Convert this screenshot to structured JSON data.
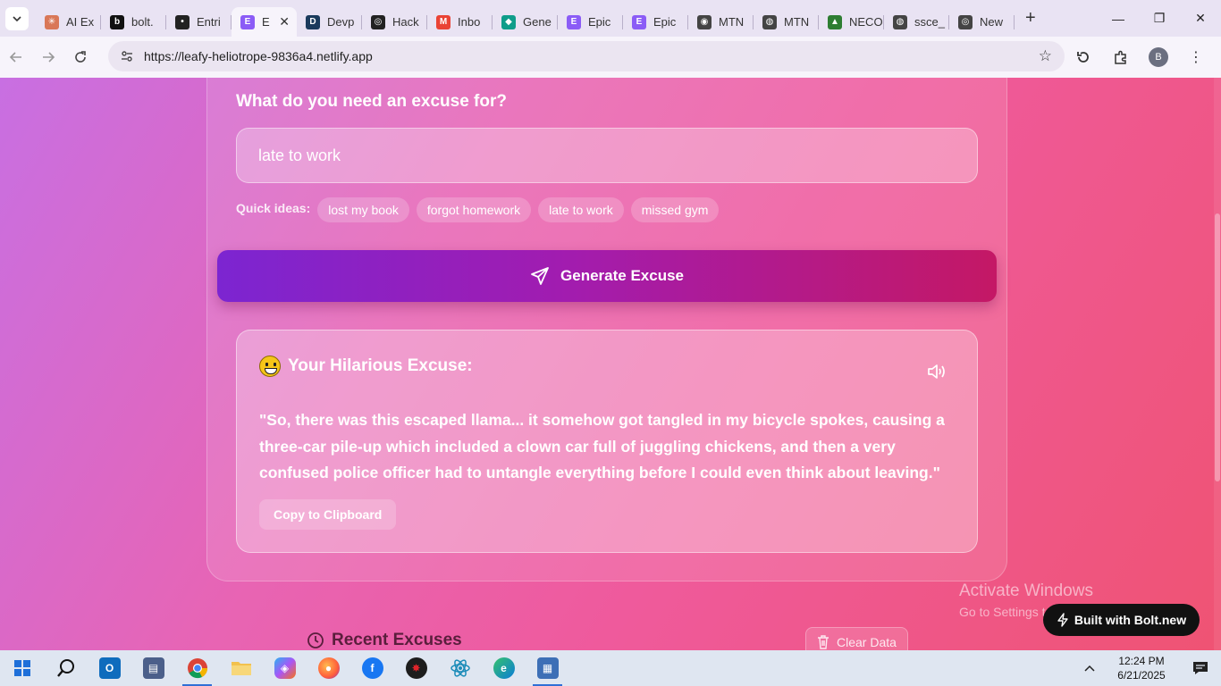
{
  "browser": {
    "tabs": [
      {
        "label": "AI Ex",
        "icon": "claude-icon",
        "color": "#d97757",
        "glyph": "✳"
      },
      {
        "label": "bolt.",
        "icon": "bolt-b-icon",
        "color": "#111111",
        "glyph": "b"
      },
      {
        "label": "Entri",
        "icon": "entri-icon",
        "color": "#222222",
        "glyph": "•"
      },
      {
        "label": "E",
        "icon": "epic-e-icon",
        "color": "#8b5cf6",
        "glyph": "E",
        "active": true
      },
      {
        "label": "Devp",
        "icon": "devpost-icon",
        "color": "#1a3a5c",
        "glyph": "D"
      },
      {
        "label": "Hack",
        "icon": "openai-icon",
        "color": "#222222",
        "glyph": "◎"
      },
      {
        "label": "Inbo",
        "icon": "gmail-icon",
        "color": "#ea4335",
        "glyph": "M"
      },
      {
        "label": "Gene",
        "icon": "diamond-icon",
        "color": "#0f9d8a",
        "glyph": "◆"
      },
      {
        "label": "Epic",
        "icon": "epic-e-icon",
        "color": "#8b5cf6",
        "glyph": "E"
      },
      {
        "label": "Epic",
        "icon": "epic-e-icon",
        "color": "#8b5cf6",
        "glyph": "E"
      },
      {
        "label": "MTN",
        "icon": "mtn-icon",
        "color": "#444444",
        "glyph": "◉"
      },
      {
        "label": "MTN",
        "icon": "globe-icon",
        "color": "#444444",
        "glyph": "◍"
      },
      {
        "label": "NECO",
        "icon": "neco-icon",
        "color": "#2e7d32",
        "glyph": "▲"
      },
      {
        "label": "ssce_",
        "icon": "globe-icon",
        "color": "#444444",
        "glyph": "◍"
      },
      {
        "label": "New",
        "icon": "chrome-icon",
        "color": "#444444",
        "glyph": "◎"
      }
    ],
    "url": "https://leafy-heliotrope-9836a4.netlify.app",
    "profile_initial": "B"
  },
  "page": {
    "question": "What do you need an excuse for?",
    "input_value": "late to work",
    "quick_label": "Quick ideas:",
    "quick_ideas": [
      "lost my book",
      "forgot homework",
      "late to work",
      "missed gym"
    ],
    "generate_label": "Generate Excuse",
    "result_title": "Your Hilarious Excuse:",
    "excuse": "\"So, there was this escaped llama... it somehow got tangled in my bicycle spokes, causing a three-car pile-up which included a clown car full of juggling chickens, and then a very confused police officer had to untangle everything before I could even think about leaving.\"",
    "copy_label": "Copy to Clipboard",
    "recent_title": "Recent Excuses",
    "clear_label": "Clear Data",
    "badge_label": "Built with Bolt.new"
  },
  "os": {
    "watermark_line1": "Activate Windows",
    "watermark_line2": "Go to Settings to activate Windows.",
    "time": "12:24 PM",
    "date": "6/21/2025"
  },
  "colors": {
    "accent_start": "#7c25d1",
    "accent_end": "#c41865"
  }
}
